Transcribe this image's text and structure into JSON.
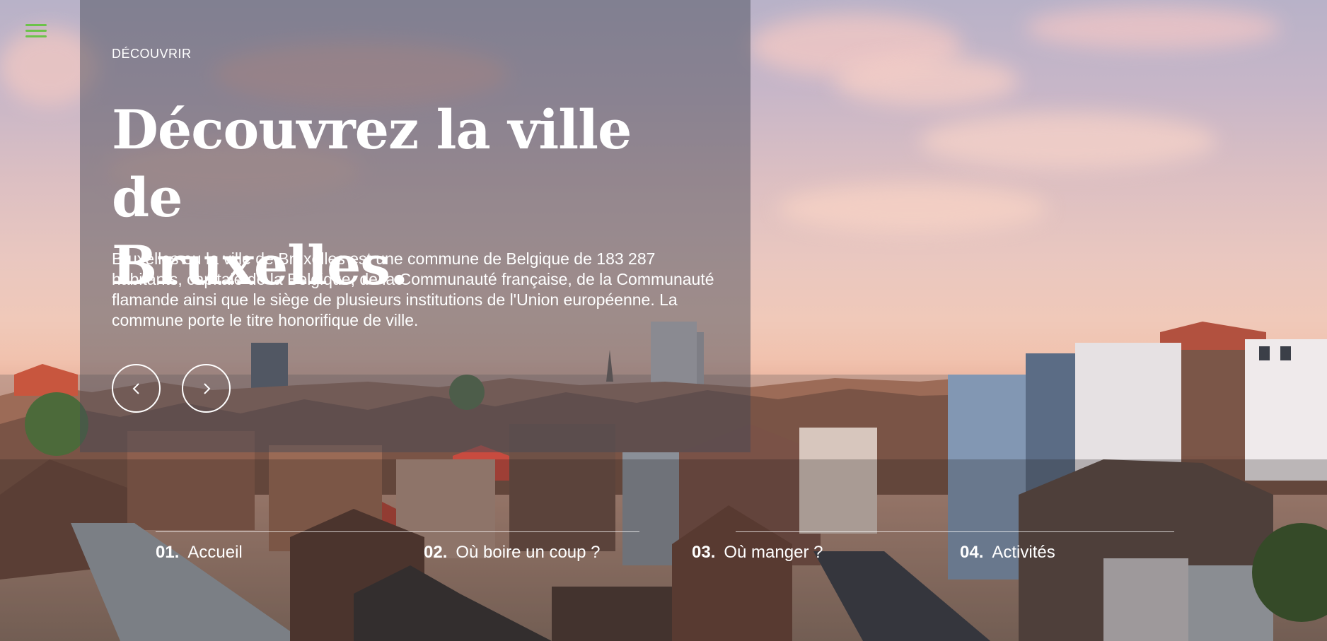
{
  "colors": {
    "menu_icon": "#6cc24a",
    "panel_overlay": "rgba(70,74,86,0.48)",
    "text": "#ffffff"
  },
  "header": {
    "menu_icon": "hamburger-icon"
  },
  "hero": {
    "eyebrow": "DÉCOUVRIR",
    "title_line1": "Découvrez la ville de",
    "title_line2": "Bruxelles.",
    "description": "Bruxelles ou la ville de Bruxelles est une commune de Belgique de 183 287 habitants, capitale de la Belgique, de la Communauté française, de la Communauté flamande ainsi que le siège de plusieurs institutions de l'Union européenne. La commune porte le titre honorifique de ville.",
    "prev_icon": "chevron-left-icon",
    "next_icon": "chevron-right-icon"
  },
  "nav": {
    "items": [
      {
        "num": "01.",
        "label": "Accueil"
      },
      {
        "num": "02.",
        "label": "Où boire un coup ?"
      },
      {
        "num": "03.",
        "label": "Où manger ?"
      },
      {
        "num": "04.",
        "label": "Activités"
      }
    ]
  }
}
